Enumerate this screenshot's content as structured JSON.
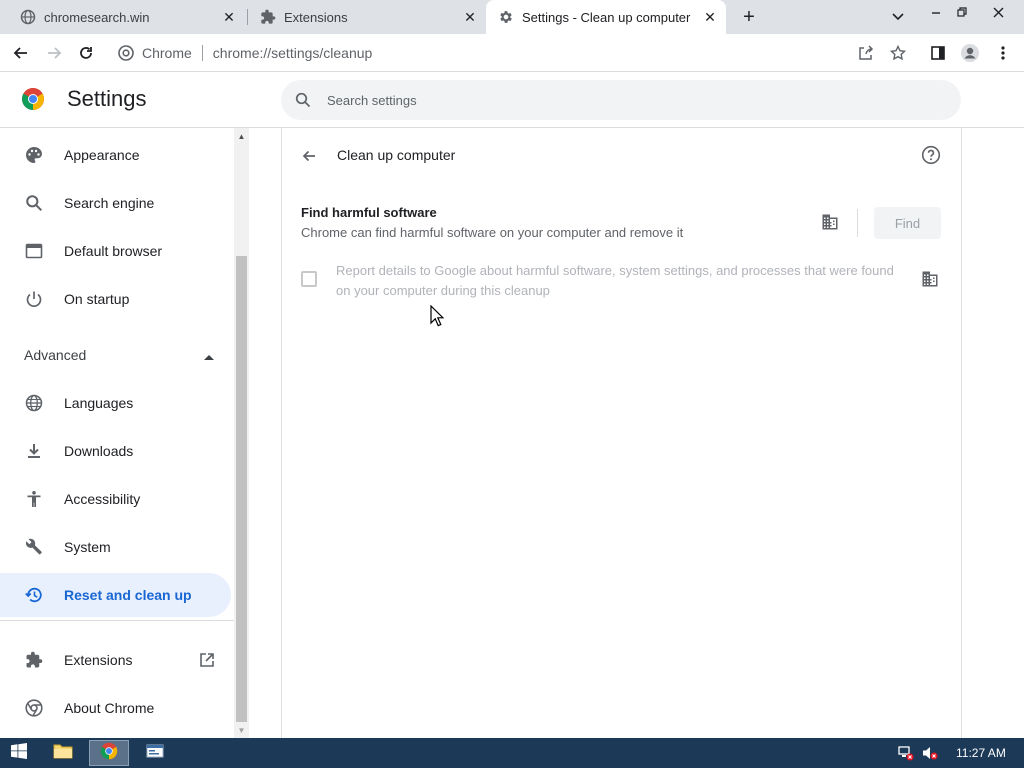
{
  "browser": {
    "tabs": [
      {
        "title": "chromesearch.win",
        "icon": "globe-icon",
        "active": false
      },
      {
        "title": "Extensions",
        "icon": "puzzle-icon",
        "active": false
      },
      {
        "title": "Settings - Clean up computer",
        "icon": "gear-icon",
        "active": true
      }
    ],
    "omnibox": {
      "chip_label": "Chrome",
      "url": "chrome://settings/cleanup"
    }
  },
  "settings": {
    "title": "Settings",
    "search_placeholder": "Search settings"
  },
  "sidebar": {
    "items": [
      {
        "label": "Appearance",
        "icon": "palette-icon"
      },
      {
        "label": "Search engine",
        "icon": "search-icon"
      },
      {
        "label": "Default browser",
        "icon": "browser-window-icon"
      },
      {
        "label": "On startup",
        "icon": "power-icon"
      }
    ],
    "advanced_label": "Advanced",
    "advanced_items": [
      {
        "label": "Languages",
        "icon": "globe-icon"
      },
      {
        "label": "Downloads",
        "icon": "download-icon"
      },
      {
        "label": "Accessibility",
        "icon": "accessibility-icon"
      },
      {
        "label": "System",
        "icon": "wrench-icon"
      },
      {
        "label": "Reset and clean up",
        "icon": "restore-icon",
        "selected": true
      }
    ],
    "footer_items": [
      {
        "label": "Extensions",
        "icon": "puzzle-icon"
      },
      {
        "label": "About Chrome",
        "icon": "chrome-icon"
      }
    ]
  },
  "cleanup": {
    "title": "Clean up computer",
    "find_title": "Find harmful software",
    "find_description": "Chrome can find harmful software on your computer and remove it",
    "find_button": "Find",
    "report_text": "Report details to Google about harmful software, system settings, and processes that were found on your computer during this cleanup",
    "report_checked": false
  },
  "taskbar": {
    "clock": "11:27 AM"
  },
  "colors": {
    "accent": "#1a73e8",
    "selected_bg": "#e8f0fe",
    "taskbar": "#1c3a57",
    "tabstrip": "#dee1e6"
  }
}
